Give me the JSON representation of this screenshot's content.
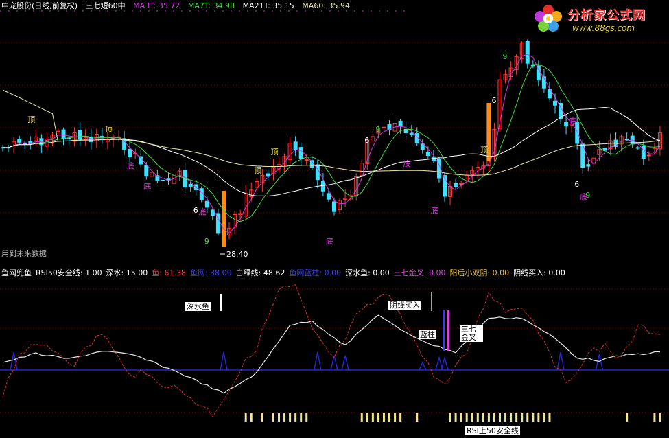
{
  "header": {
    "stock": "中宠股份(日线,前复权)",
    "indicator": "三七短60中",
    "ma": [
      {
        "label": "MA3T:",
        "value": "35.72",
        "color": "#d23be0"
      },
      {
        "label": "MA7T:",
        "value": "34.98",
        "color": "#3fdc3f"
      },
      {
        "label": "MA21T:",
        "value": "35.15",
        "color": "#ffffff"
      },
      {
        "label": "MA60:",
        "value": "35.94",
        "color": "#e8e8a8"
      }
    ]
  },
  "logo": {
    "title": "分析家公式网",
    "url": "www.88gs.com"
  },
  "price_panel": {
    "future_data_label": "用到未来数据",
    "low_price_label": "28.40",
    "markers": {
      "top": "顶",
      "bottom": "底",
      "six": "6",
      "nine": "9"
    },
    "up_color": "#ff3b3b",
    "down_color": "#3fe0ff",
    "signal_color": "#ff8c1a"
  },
  "indicator_header": {
    "name": "鱼网兜鱼",
    "items": [
      {
        "label": "RSI50安全线:",
        "value": "1.00",
        "color": "#ffffff"
      },
      {
        "label": "深水:",
        "value": "15.00",
        "color": "#ffffff"
      },
      {
        "label": "鱼:",
        "value": "61.38",
        "color": "#ff3b3b"
      },
      {
        "label": "鱼网:",
        "value": "38.00",
        "color": "#3b3bff"
      },
      {
        "label": "白绿线:",
        "value": "48.62",
        "color": "#ffffff"
      },
      {
        "label": "鱼网蓝柱:",
        "value": "0.00",
        "color": "#3b3bff"
      },
      {
        "label": "深水鱼:",
        "value": "0.00",
        "color": "#ffffff"
      },
      {
        "label": "三七金叉:",
        "value": "0.00",
        "color": "#e040e0"
      },
      {
        "label": "阳后小双阴:",
        "value": "0.00",
        "color": "#e8c040"
      },
      {
        "label": "阴线买入:",
        "value": "0.00",
        "color": "#ffffff"
      }
    ]
  },
  "indicator_tags": {
    "deep_water_fish": "深水鱼",
    "yin_buy": "阴线买入",
    "blue_column": "蓝柱",
    "golden_cross": "三七金叉",
    "rsi_safe": "RSI上50安全线"
  },
  "chart_data": {
    "type": "candlestick",
    "x_count": 120,
    "price_range_hint": [
      28.4,
      47
    ],
    "annotated_low": 28.4
  }
}
